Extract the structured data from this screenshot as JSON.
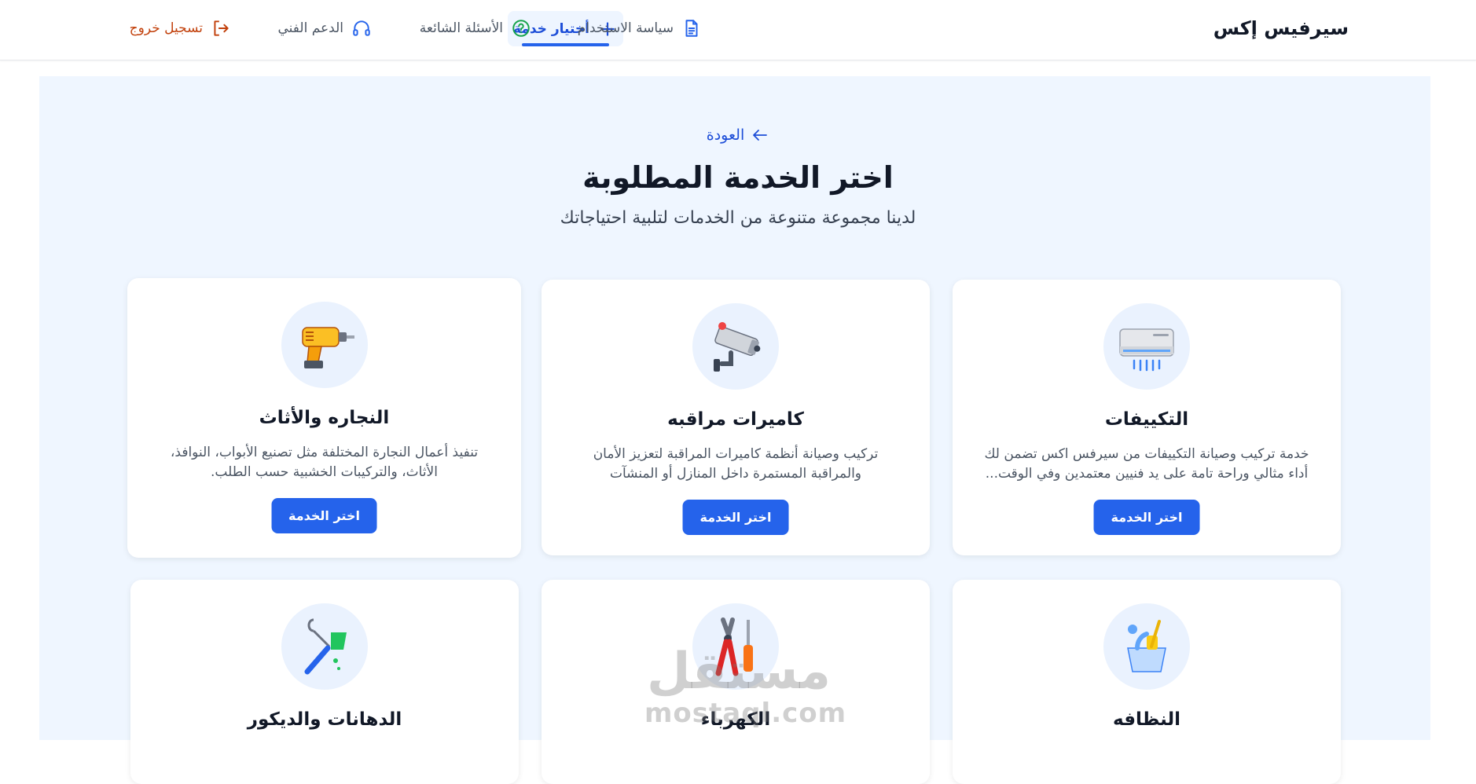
{
  "header": {
    "brand": "سيرفيس إكس",
    "nav": {
      "choose_service": "أختيار خدمة",
      "usage_policy": "سياسة الاستخدام",
      "faq": "الأسئلة الشائعة",
      "support": "الدعم الفني",
      "logout": "تسجيل خروج"
    }
  },
  "page": {
    "back_label": "العودة",
    "title": "اختر الخدمة المطلوبة",
    "subtitle": "لدينا مجموعة متنوعة من الخدمات لتلبية احتياجاتك"
  },
  "services": [
    {
      "title": "التكييفات",
      "description": "خدمة تركيب وصيانة التكييفات من سيرفس اكس تضمن لك أداء مثالي وراحة تامة على يد فنيين معتمدين وفي الوقت...",
      "button": "اختر الخدمة",
      "icon": "air-conditioner-icon"
    },
    {
      "title": "كاميرات مراقبه",
      "description": "تركيب وصيانة أنظمة كاميرات المراقبة لتعزيز الأمان والمراقبة المستمرة داخل المنازل أو المنشآت",
      "button": "اختر الخدمة",
      "icon": "security-camera-icon"
    },
    {
      "title": "النجاره والأثاث",
      "description": "تنفيذ أعمال النجارة المختلفة مثل تصنيع الأبواب، النوافذ، الأثاث، والتركيبات الخشبية حسب الطلب.",
      "button": "اختر الخدمة",
      "icon": "power-drill-icon"
    },
    {
      "title": "النظافه",
      "icon": "cleaning-bucket-icon"
    },
    {
      "title": "الكهرباء",
      "icon": "pliers-screwdriver-icon"
    },
    {
      "title": "الدهانات والديكور",
      "icon": "paint-roller-icon"
    }
  ],
  "watermark": {
    "arabic": "مستقل",
    "latin": "mostaql.com"
  },
  "colors": {
    "primary": "#2563eb",
    "panel_bg": "#eff6ff",
    "logout": "#c2410c"
  }
}
